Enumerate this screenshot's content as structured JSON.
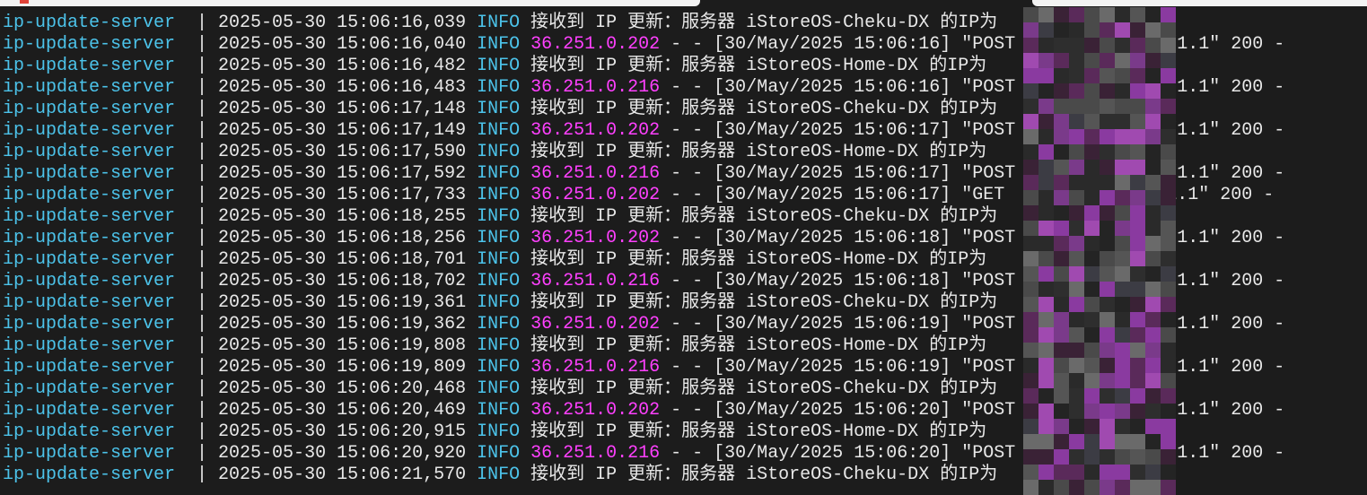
{
  "service": "ip-update-server",
  "separator": "|",
  "level": "INFO",
  "recv_prefix": "接收到 IP 更新：服务器",
  "recv_suffix": "的IP为",
  "access_date": "30/May/2025",
  "access_tail": "HTTP/1.1\" 200 -",
  "colors": {
    "background": "#1c1c1c",
    "service": "#4cc3ea",
    "ip": "#ff40ff",
    "text": "#e8e8e8"
  },
  "lines": [
    {
      "ts": "2025-05-30 15:06:16,039",
      "type": "recv",
      "server": "iStoreOS-Cheku-DX"
    },
    {
      "ts": "2025-05-30 15:06:16,040",
      "type": "access",
      "ip": "36.251.0.202",
      "time": "15:06:16",
      "method": "POST"
    },
    {
      "ts": "2025-05-30 15:06:16,482",
      "type": "recv",
      "server": "iStoreOS-Home-DX"
    },
    {
      "ts": "2025-05-30 15:06:16,483",
      "type": "access",
      "ip": "36.251.0.216",
      "time": "15:06:16",
      "method": "POST"
    },
    {
      "ts": "2025-05-30 15:06:17,148",
      "type": "recv",
      "server": "iStoreOS-Cheku-DX"
    },
    {
      "ts": "2025-05-30 15:06:17,149",
      "type": "access",
      "ip": "36.251.0.202",
      "time": "15:06:17",
      "method": "POST"
    },
    {
      "ts": "2025-05-30 15:06:17,590",
      "type": "recv",
      "server": "iStoreOS-Home-DX"
    },
    {
      "ts": "2025-05-30 15:06:17,592",
      "type": "access",
      "ip": "36.251.0.216",
      "time": "15:06:17",
      "method": "POST"
    },
    {
      "ts": "2025-05-30 15:06:17,733",
      "type": "access",
      "ip": "36.251.0.202",
      "time": "15:06:17",
      "method": "GET"
    },
    {
      "ts": "2025-05-30 15:06:18,255",
      "type": "recv",
      "server": "iStoreOS-Cheku-DX"
    },
    {
      "ts": "2025-05-30 15:06:18,256",
      "type": "access",
      "ip": "36.251.0.202",
      "time": "15:06:18",
      "method": "POST"
    },
    {
      "ts": "2025-05-30 15:06:18,701",
      "type": "recv",
      "server": "iStoreOS-Home-DX"
    },
    {
      "ts": "2025-05-30 15:06:18,702",
      "type": "access",
      "ip": "36.251.0.216",
      "time": "15:06:18",
      "method": "POST"
    },
    {
      "ts": "2025-05-30 15:06:19,361",
      "type": "recv",
      "server": "iStoreOS-Cheku-DX"
    },
    {
      "ts": "2025-05-30 15:06:19,362",
      "type": "access",
      "ip": "36.251.0.202",
      "time": "15:06:19",
      "method": "POST"
    },
    {
      "ts": "2025-05-30 15:06:19,808",
      "type": "recv",
      "server": "iStoreOS-Home-DX"
    },
    {
      "ts": "2025-05-30 15:06:19,809",
      "type": "access",
      "ip": "36.251.0.216",
      "time": "15:06:19",
      "method": "POST"
    },
    {
      "ts": "2025-05-30 15:06:20,468",
      "type": "recv",
      "server": "iStoreOS-Cheku-DX"
    },
    {
      "ts": "2025-05-30 15:06:20,469",
      "type": "access",
      "ip": "36.251.0.202",
      "time": "15:06:20",
      "method": "POST"
    },
    {
      "ts": "2025-05-30 15:06:20,915",
      "type": "recv",
      "server": "iStoreOS-Home-DX"
    },
    {
      "ts": "2025-05-30 15:06:20,920",
      "type": "access",
      "ip": "36.251.0.216",
      "time": "15:06:20",
      "method": "POST"
    },
    {
      "ts": "2025-05-30 15:06:21,570",
      "type": "recv",
      "server": "iStoreOS-Cheku-DX"
    }
  ]
}
